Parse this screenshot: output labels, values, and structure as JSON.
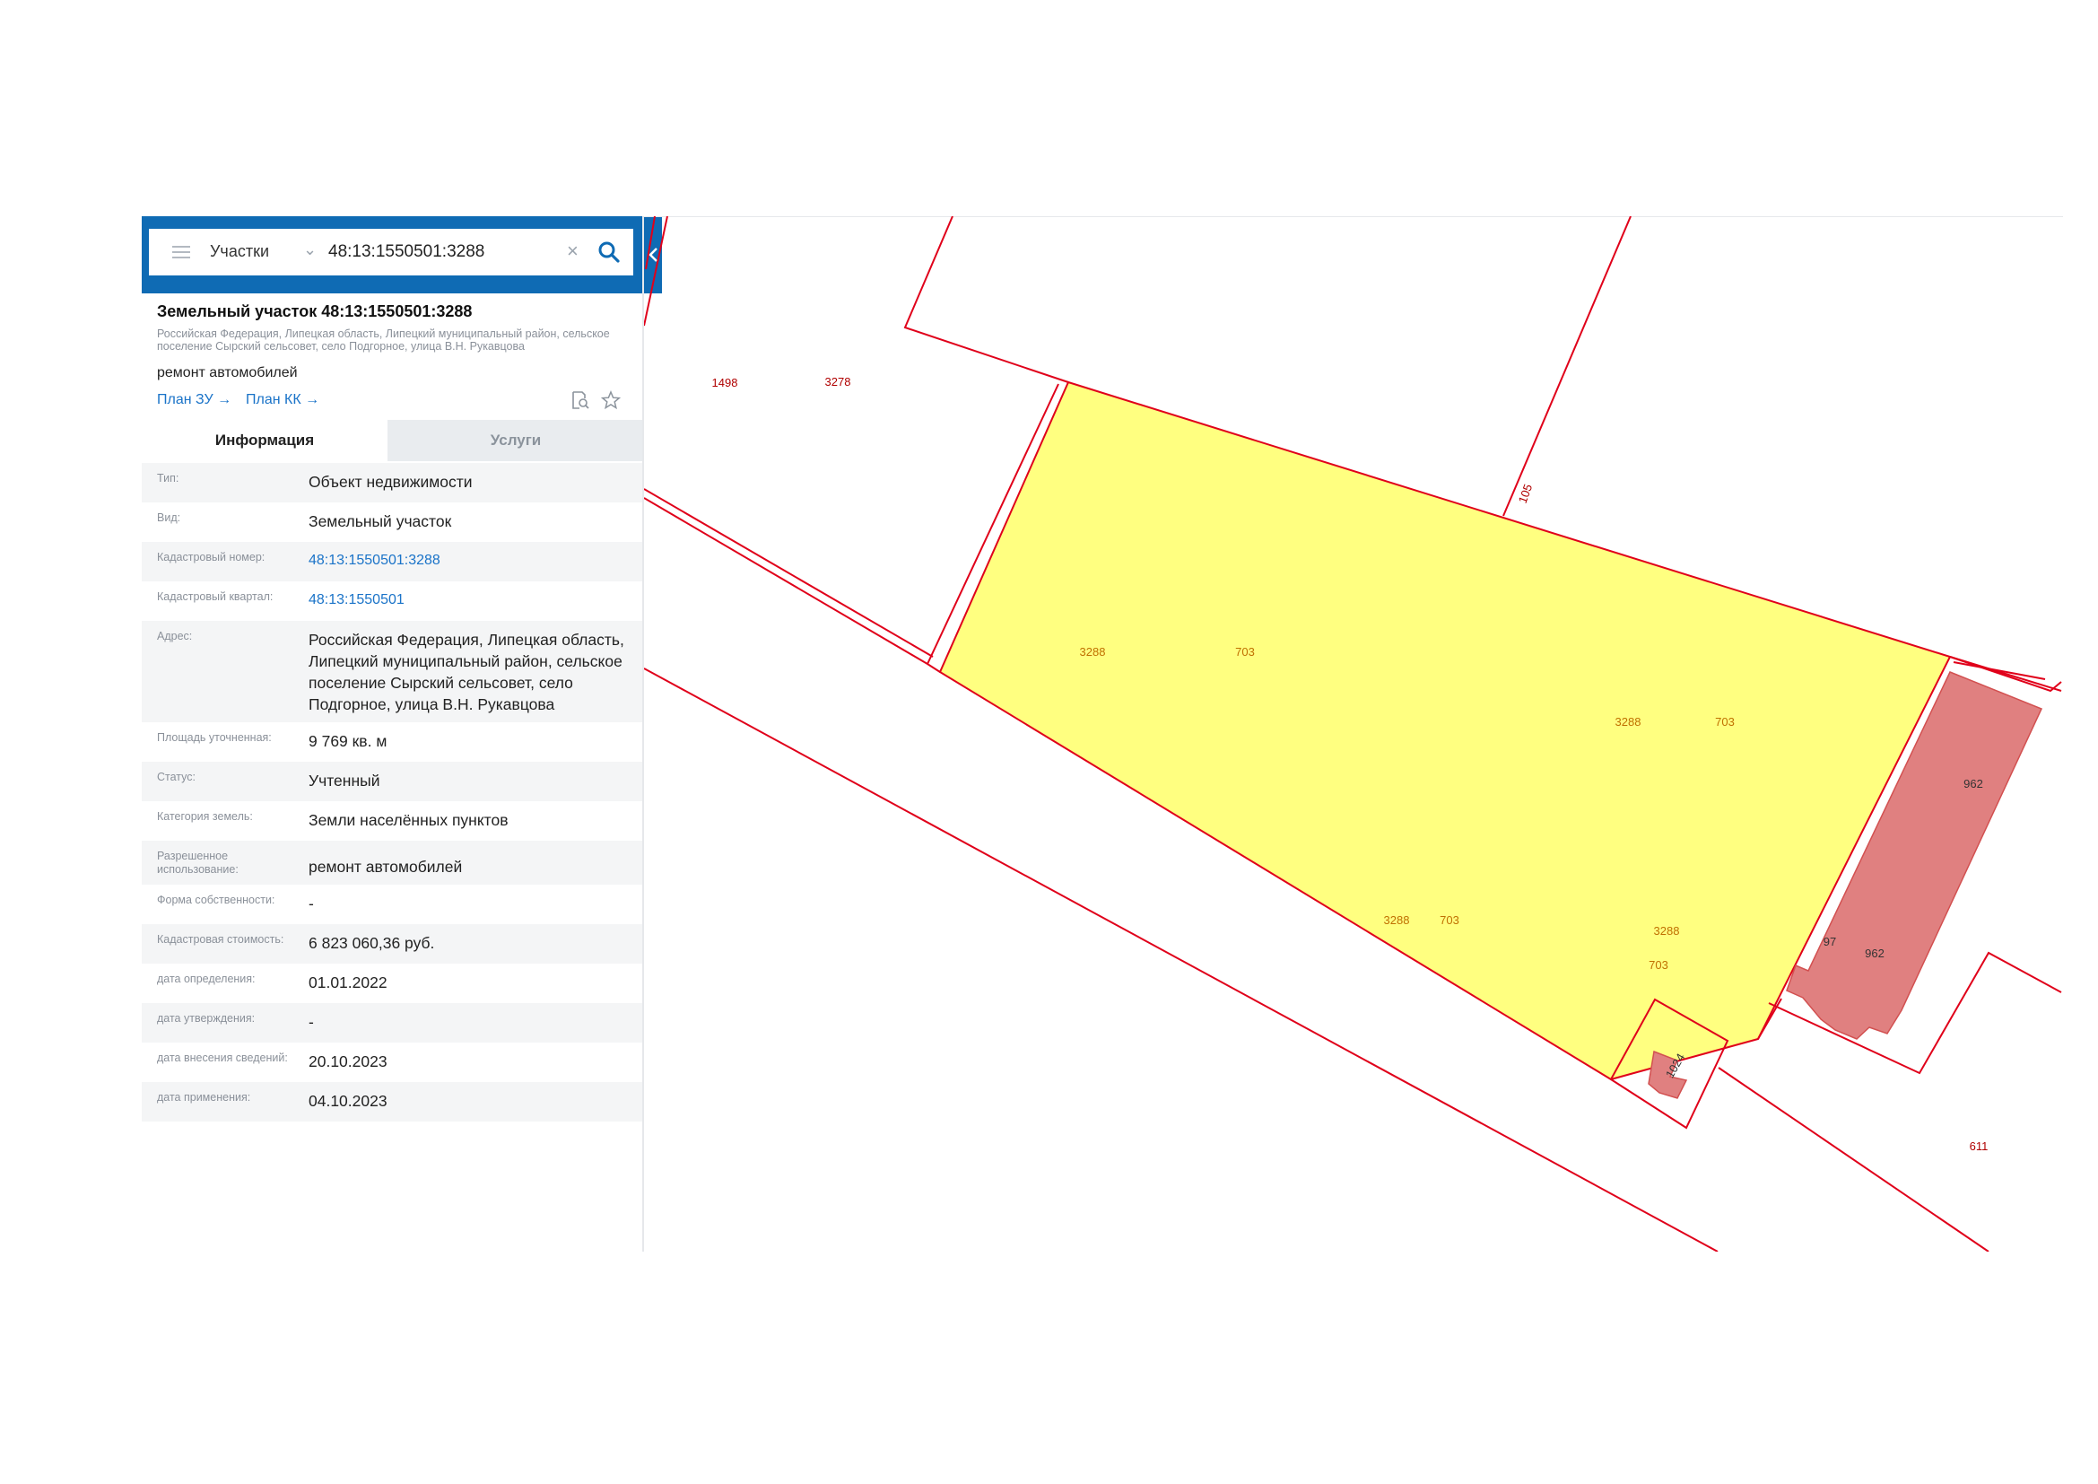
{
  "search": {
    "category": "Участки",
    "query": "48:13:1550501:3288"
  },
  "object": {
    "title": "Земельный участок 48:13:1550501:3288",
    "address": "Российская Федерация, Липецкая область, Липецкий муниципальный район, сельское поселение Сырский сельсовет, село Подгорное, улица В.Н. Рукавцова",
    "usage": "ремонт автомобилей",
    "plan_zu": "План ЗУ →",
    "plan_kk": "План КК →"
  },
  "tabs": {
    "info": "Информация",
    "services": "Услуги"
  },
  "info_rows": [
    {
      "label": "Тип:",
      "value": "Объект недвижимости"
    },
    {
      "label": "Вид:",
      "value": "Земельный участок"
    },
    {
      "label": "Кадастровый номер:",
      "value": "48:13:1550501:3288"
    },
    {
      "label": "Кадастровый квартал:",
      "value": "48:13:1550501"
    },
    {
      "label": "Адрес:",
      "value": "Российская Федерация, Липецкая область, Липецкий муниципальный район, сельское поселение Сырский сельсовет, село Подгорное, улица В.Н. Рукавцова"
    },
    {
      "label": "Площадь уточненная:",
      "value": "9 769 кв. м"
    },
    {
      "label": "Статус:",
      "value": "Учтенный"
    },
    {
      "label": "Категория земель:",
      "value": "Земли населённых пунктов"
    },
    {
      "label": "Разрешенное использование:",
      "value": "ремонт автомобилей"
    },
    {
      "label": "Форма собственности:",
      "value": "-"
    },
    {
      "label": "Кадастровая стоимость:",
      "value": "6 823 060,36 руб."
    },
    {
      "label": "дата определения:",
      "value": "01.01.2022"
    },
    {
      "label": "дата утверждения:",
      "value": "-"
    },
    {
      "label": "дата внесения сведений:",
      "value": "20.10.2023"
    },
    {
      "label": "дата применения:",
      "value": "04.10.2023"
    }
  ],
  "map": {
    "labels": {
      "l1498": "1498",
      "l3278": "3278",
      "l105": "105",
      "p3288a": "3288",
      "p703a": "703",
      "p3288b": "3288",
      "p703b": "703",
      "p3288c": "3288",
      "p703c": "703",
      "p3288d": "3288",
      "p703d": "703",
      "b962a": "962",
      "b962b": "962",
      "l97": "97",
      "b1024": "1024",
      "l611": "611"
    },
    "colors": {
      "parcel_fill": "#ffff80",
      "boundary": "#e0001a",
      "building_fill": "#e08080",
      "label_selected": "#c07000",
      "label_other": "#b00000"
    }
  }
}
